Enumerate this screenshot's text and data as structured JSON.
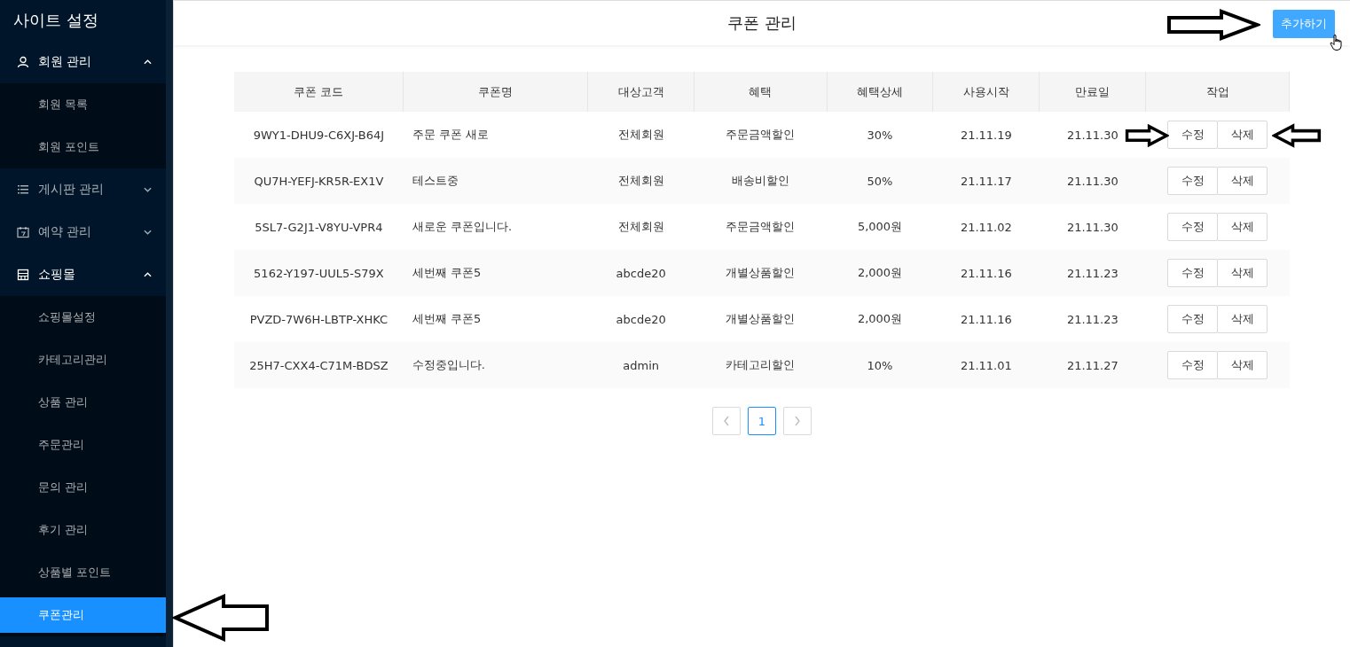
{
  "sidebar": {
    "title": "사이트 설정",
    "menu": [
      {
        "label": "회원 관리",
        "expanded": true,
        "children": [
          {
            "label": "회원 목록",
            "selected": false
          },
          {
            "label": "회원 포인트",
            "selected": false
          }
        ]
      },
      {
        "label": "게시판 관리",
        "expanded": false
      },
      {
        "label": "예약 관리",
        "expanded": false
      },
      {
        "label": "쇼핑몰",
        "expanded": true,
        "children": [
          {
            "label": "쇼핑몰설정",
            "selected": false
          },
          {
            "label": "카테고리관리",
            "selected": false
          },
          {
            "label": "상품 관리",
            "selected": false
          },
          {
            "label": "주문관리",
            "selected": false
          },
          {
            "label": "문의 관리",
            "selected": false
          },
          {
            "label": "후기 관리",
            "selected": false
          },
          {
            "label": "상품별 포인트",
            "selected": false
          },
          {
            "label": "쿠폰관리",
            "selected": true
          }
        ]
      }
    ]
  },
  "header": {
    "title": "쿠폰 관리",
    "add_button": "추가하기"
  },
  "table": {
    "columns": [
      "쿠폰 코드",
      "쿠폰명",
      "대상고객",
      "혜택",
      "혜택상세",
      "사용시작",
      "만료일",
      "작업"
    ],
    "rows": [
      {
        "cells": [
          "9WY1-DHU9-C6XJ-B64J",
          "주문 쿠폰 새로",
          "전체회원",
          "주문금액할인",
          "30%",
          "21.11.19",
          "21.11.30"
        ],
        "actions": [
          "수정",
          "삭제"
        ]
      },
      {
        "cells": [
          "QU7H-YEFJ-KR5R-EX1V",
          "테스트중",
          "전체회원",
          "배송비할인",
          "50%",
          "21.11.17",
          "21.11.30"
        ],
        "actions": [
          "수정",
          "삭제"
        ]
      },
      {
        "cells": [
          "5SL7-G2J1-V8YU-VPR4",
          "새로운 쿠폰입니다.",
          "전체회원",
          "주문금액할인",
          "5,000원",
          "21.11.02",
          "21.11.30"
        ],
        "actions": [
          "수정",
          "삭제"
        ]
      },
      {
        "cells": [
          "5162-Y197-UUL5-S79X",
          "세번째 쿠폰5",
          "abcde20",
          "개별상품할인",
          "2,000원",
          "21.11.16",
          "21.11.23"
        ],
        "actions": [
          "수정",
          "삭제"
        ]
      },
      {
        "cells": [
          "PVZD-7W6H-LBTP-XHKC",
          "세번째 쿠폰5",
          "abcde20",
          "개별상품할인",
          "2,000원",
          "21.11.16",
          "21.11.23"
        ],
        "actions": [
          "수정",
          "삭제"
        ]
      },
      {
        "cells": [
          "25H7-CXX4-C71M-BDSZ",
          "수정중입니다.",
          "admin",
          "카테고리할인",
          "10%",
          "21.11.01",
          "21.11.27"
        ],
        "actions": [
          "수정",
          "삭제"
        ]
      }
    ]
  },
  "pagination": {
    "pages": [
      {
        "label": "1",
        "selected": true
      }
    ]
  }
}
